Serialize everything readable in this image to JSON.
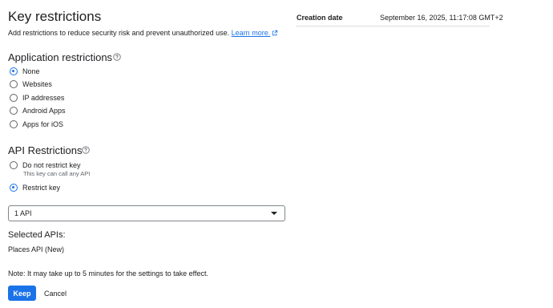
{
  "header": {
    "title": "Key restrictions",
    "subtitle": "Add restrictions to reduce security risk and prevent unauthorized use.",
    "learn_more": "Learn more."
  },
  "meta": {
    "creation_label": "Creation date",
    "creation_value": "September 16, 2025, 11:17:08 GMT+2"
  },
  "application_restrictions": {
    "heading": "Application restrictions",
    "options": [
      {
        "label": "None",
        "checked": true
      },
      {
        "label": "Websites",
        "checked": false
      },
      {
        "label": "IP addresses",
        "checked": false
      },
      {
        "label": "Android Apps",
        "checked": false
      },
      {
        "label": "Apps for iOS",
        "checked": false
      }
    ]
  },
  "api_restrictions": {
    "heading": "API Restrictions",
    "options": [
      {
        "label": "Do not restrict key",
        "sublabel": "This key can call any API",
        "checked": false
      },
      {
        "label": "Restrict key",
        "checked": true
      }
    ],
    "select_value": "1 API"
  },
  "selected_apis": {
    "heading": "Selected APIs:",
    "items": [
      "Places API (New)"
    ]
  },
  "note": "Note: It may take up to 5 minutes for the settings to take effect.",
  "actions": {
    "keep": "Keep",
    "cancel": "Cancel"
  },
  "colors": {
    "accent": "#1a73e8",
    "text": "#202124",
    "secondary_text": "#5f6368"
  },
  "icons": {
    "help": "help-circle-icon",
    "external": "external-link-icon",
    "dropdown": "dropdown-arrow-icon"
  }
}
